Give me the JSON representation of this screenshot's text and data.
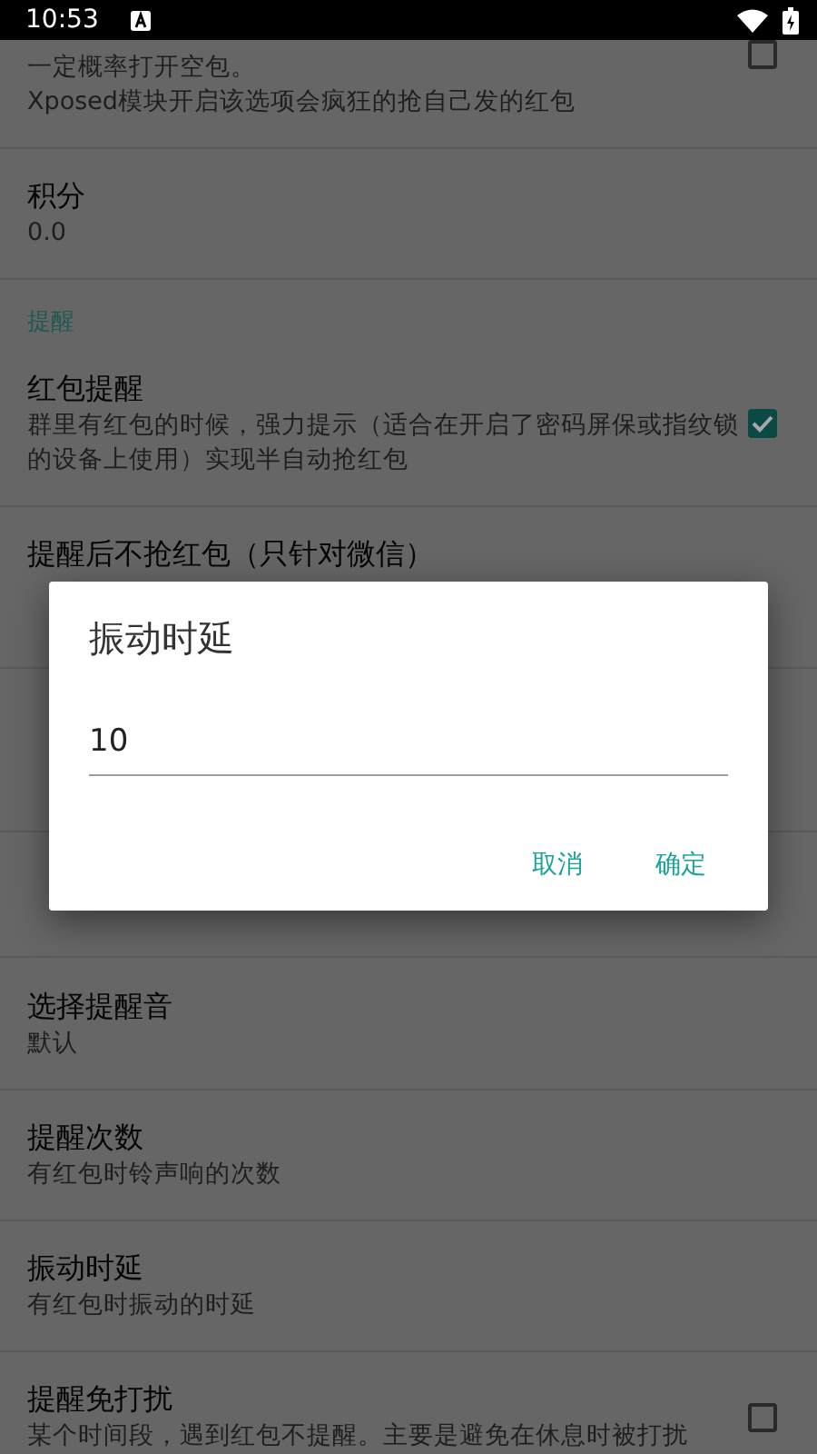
{
  "status_bar": {
    "time": "10:53"
  },
  "list": [
    {
      "kind": "pref",
      "summary": [
        "一定概率打开空包。",
        "Xposed模块开启该选项会疯狂的抢自己发的红包"
      ],
      "checked": false
    },
    {
      "kind": "pref",
      "title": "积分",
      "summary": [
        "0.0"
      ]
    },
    {
      "kind": "category",
      "title": "提醒"
    },
    {
      "kind": "pref",
      "title": "红包提醒",
      "summary": [
        "群里有红包的时候，强力提示（适合在开启了密码屏保或指纹锁",
        "的设备上使用）实现半自动抢红包"
      ],
      "checked": true
    },
    {
      "kind": "pref",
      "title": "提醒后不抢红包（只针对微信）"
    },
    {
      "kind": "covered"
    },
    {
      "kind": "pref",
      "title": "选择提醒音",
      "summary": [
        "默认"
      ]
    },
    {
      "kind": "pref",
      "title": "提醒次数",
      "summary": [
        "有红包时铃声响的次数"
      ]
    },
    {
      "kind": "pref",
      "title": "振动时延",
      "summary": [
        "有红包时振动的时延"
      ]
    },
    {
      "kind": "pref",
      "title": "提醒免打扰",
      "summary": [
        "某个时间段，遇到红包不提醒。主要是避免在休息时被打扰"
      ],
      "checked": false
    }
  ],
  "dialog": {
    "title": "振动时延",
    "value": "10",
    "buttons": [
      "取消",
      "确定"
    ]
  }
}
